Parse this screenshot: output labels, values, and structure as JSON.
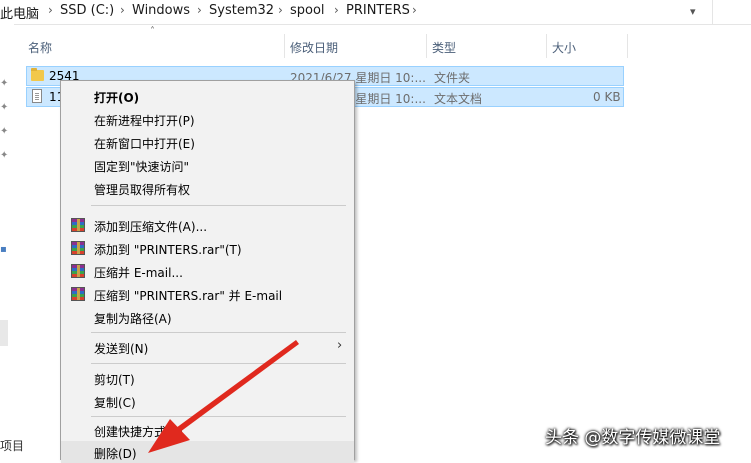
{
  "address_bar": {
    "crumbs": [
      "此电脑",
      "SSD (C:)",
      "Windows",
      "System32",
      "spool",
      "PRINTERS"
    ]
  },
  "columns": {
    "name": "名称",
    "date": "修改日期",
    "type": "类型",
    "size": "大小"
  },
  "files": [
    {
      "name": "2541",
      "date": "2021/6/27 星期日 10:...",
      "type": "文件夹",
      "size": "",
      "icon": "folder-icon"
    },
    {
      "name": "11",
      "date": "2021/6/27 星期日 10:...",
      "type": "文本文档",
      "size": "0 KB",
      "icon": "text-document-icon"
    }
  ],
  "context_menu": {
    "items": [
      {
        "label": "打开(O)"
      },
      {
        "label": "在新进程中打开(P)"
      },
      {
        "label": "在新窗口中打开(E)"
      },
      {
        "label": "固定到\"快速访问\""
      },
      {
        "label": "管理员取得所有权"
      },
      {
        "label": "添加到压缩文件(A)...",
        "icon": "winrar-icon"
      },
      {
        "label": "添加到 \"PRINTERS.rar\"(T)",
        "icon": "winrar-icon"
      },
      {
        "label": "压缩并 E-mail...",
        "icon": "winrar-icon"
      },
      {
        "label": "压缩到 \"PRINTERS.rar\" 并 E-mail",
        "icon": "winrar-icon"
      },
      {
        "label": "复制为路径(A)"
      },
      {
        "label": "发送到(N)"
      },
      {
        "label": "剪切(T)"
      },
      {
        "label": "复制(C)"
      },
      {
        "label": "创建快捷方式(S)"
      },
      {
        "label": "删除(D)"
      }
    ]
  },
  "left_pane": {
    "label": "项目"
  },
  "watermark": "头条 @数字传媒微课堂",
  "colors": {
    "selection": "#cce8ff",
    "selection_border": "#99d1ff",
    "arrow": "#e0291e",
    "menu_bg": "#f2f2f2"
  }
}
